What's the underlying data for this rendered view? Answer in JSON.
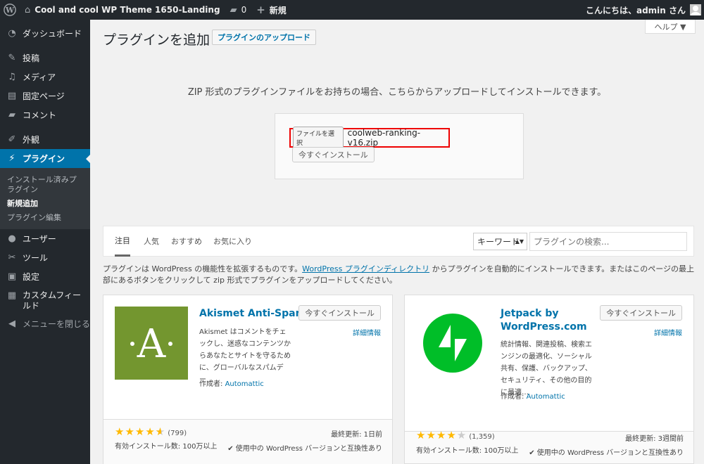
{
  "adminbar": {
    "wp_logo": "wordpress-icon",
    "site_name": "Cool and cool WP Theme 1650-Landing",
    "comments_count": "0",
    "new_label": "新規",
    "greeting": "こんにちは、admin さん"
  },
  "sidebar": {
    "items": [
      {
        "label": "ダッシュボード",
        "icon": "dashboard-icon"
      },
      {
        "label": "投稿",
        "icon": "pin-icon"
      },
      {
        "label": "メディア",
        "icon": "media-icon"
      },
      {
        "label": "固定ページ",
        "icon": "page-icon"
      },
      {
        "label": "コメント",
        "icon": "comment-icon"
      },
      {
        "label": "外観",
        "icon": "appearance-icon"
      },
      {
        "label": "プラグイン",
        "icon": "plugin-icon"
      },
      {
        "label": "ユーザー",
        "icon": "user-icon"
      },
      {
        "label": "ツール",
        "icon": "wrench-icon"
      },
      {
        "label": "設定",
        "icon": "settings-icon"
      },
      {
        "label": "カスタムフィールド",
        "icon": "grid-icon"
      },
      {
        "label": "メニューを閉じる",
        "icon": "collapse-icon"
      }
    ],
    "submenu": [
      {
        "label": "インストール済みプラグイン"
      },
      {
        "label": "新規追加"
      },
      {
        "label": "プラグイン編集"
      }
    ]
  },
  "header": {
    "help": "ヘルプ ▼",
    "title": "プラグインを追加",
    "upload_button": "プラグインのアップロード"
  },
  "upload": {
    "message": "ZIP 形式のプラグインファイルをお持ちの場合、こちらからアップロードしてインストールできます。",
    "file_button": "ファイルを選択",
    "file_name": "coolweb-ranking-v16.zip",
    "install_button": "今すぐインストール"
  },
  "filter": {
    "tabs": [
      "注目",
      "人気",
      "おすすめ",
      "お気に入り"
    ],
    "search_type": "キーワード",
    "search_placeholder": "プラグインの検索..."
  },
  "description": {
    "part1": "プラグインは WordPress の機能性を拡張するものです。",
    "link": "WordPress プラグインディレクトリ",
    "part2": " からプラグインを自動的にインストールできます。またはこのページの最上部にあるボタンをクリックして zip 形式でプラグインをアップロードしてください。"
  },
  "plugins": [
    {
      "name": "Akismet Anti-Spam",
      "install": "今すぐインストール",
      "details": "詳細情報",
      "description": "Akismet はコメントをチェックし、迷惑なコンテンツからあなたとサイトを守るために、グローバルなスパムデー…",
      "author_label": "作成者: ",
      "author": "Automattic",
      "rating": 4.5,
      "rating_count": "(799)",
      "updated": "最終更新: 1日前",
      "installs": "有効インストール数: 100万以上",
      "compat": "✔ 使用中の WordPress バージョンと互換性あり",
      "icon_color": "#73962f",
      "icon_glyph": "·A·"
    },
    {
      "name": "Jetpack by WordPress.com",
      "install": "今すぐインストール",
      "details": "詳細情報",
      "description": "統計情報、関連投稿、検索エンジンの最適化、ソーシャル共有、保護、バックアップ、セキュリティ、その他の目的に最適…",
      "author_label": "作成者: ",
      "author": "Automattic",
      "rating": 4,
      "rating_count": "(1,359)",
      "updated": "最終更新: 3週間前",
      "installs": "有効インストール数: 100万以上",
      "compat": "✔ 使用中の WordPress バージョンと互換性あり",
      "icon_color": "#00be28"
    }
  ]
}
